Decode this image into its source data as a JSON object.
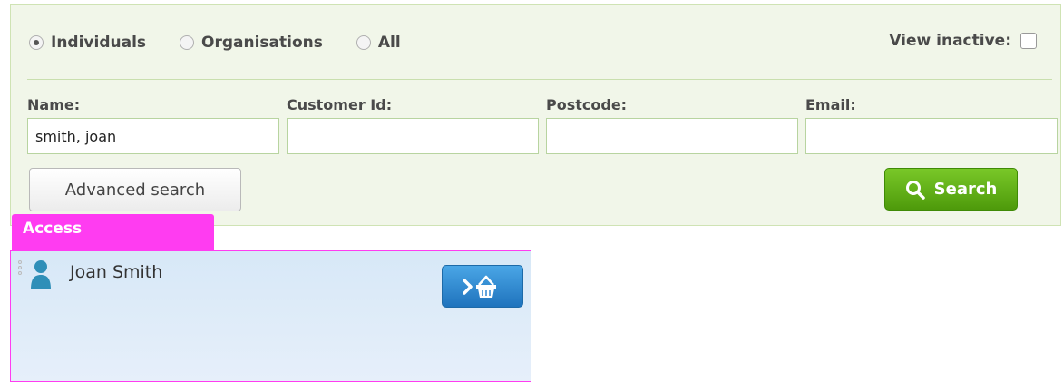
{
  "search": {
    "entity_types": [
      {
        "label": "Individuals",
        "selected": true
      },
      {
        "label": "Organisations",
        "selected": false
      },
      {
        "label": "All",
        "selected": false
      }
    ],
    "view_inactive": {
      "label": "View inactive:",
      "checked": false
    },
    "fields": {
      "name": {
        "label": "Name:",
        "value": "smith, joan"
      },
      "customer_id": {
        "label": "Customer Id:",
        "value": ""
      },
      "postcode": {
        "label": "Postcode:",
        "value": ""
      },
      "email": {
        "label": "Email:",
        "value": ""
      }
    },
    "advanced_button": "Advanced search",
    "search_button": "Search"
  },
  "results": {
    "group_label": "Access",
    "items": [
      {
        "name": "Joan Smith",
        "icon": "person-icon",
        "action_icon": "add-to-basket-icon"
      }
    ]
  },
  "colors": {
    "panel_bg": "#f1f6e9",
    "search_green": "#5fae14",
    "access_magenta": "#ff3cf1",
    "result_blue": "#d7e8f7",
    "action_blue": "#2f86d0"
  }
}
